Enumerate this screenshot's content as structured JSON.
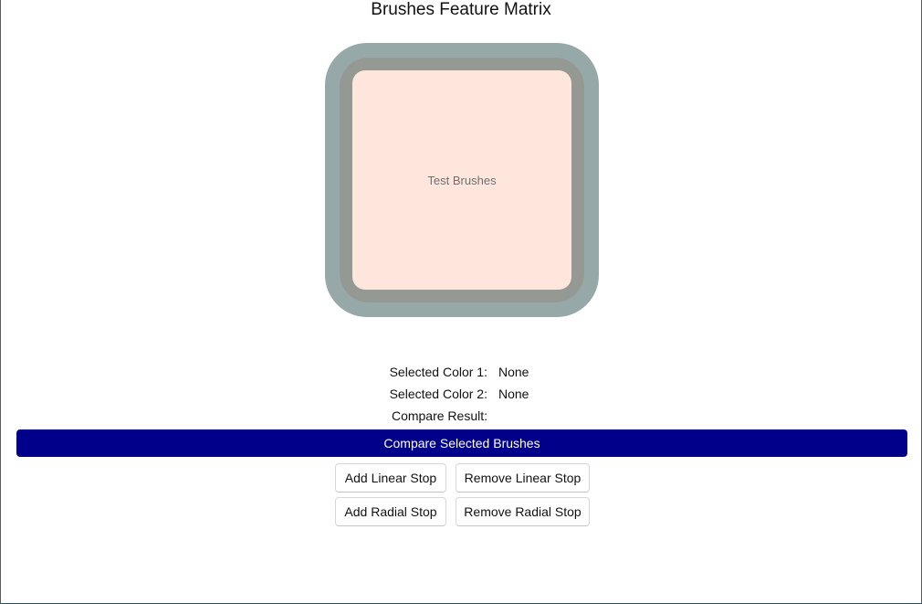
{
  "page": {
    "title": "Brushes Feature Matrix"
  },
  "preview": {
    "label": "Test Brushes",
    "colors": {
      "outer_border": "#97a8a8",
      "inner_border": "#959994",
      "fill": "#ffe6dd"
    }
  },
  "info": {
    "color1_label": "Selected Color 1:",
    "color1_value": "None",
    "color2_label": "Selected Color 2:",
    "color2_value": "None",
    "compare_label": "Compare Result:",
    "compare_value": ""
  },
  "buttons": {
    "compare": "Compare Selected Brushes",
    "add_linear": "Add Linear Stop",
    "remove_linear": "Remove Linear Stop",
    "add_radial": "Add Radial Stop",
    "remove_radial": "Remove Radial Stop"
  },
  "theme": {
    "accent": "#00008b"
  }
}
